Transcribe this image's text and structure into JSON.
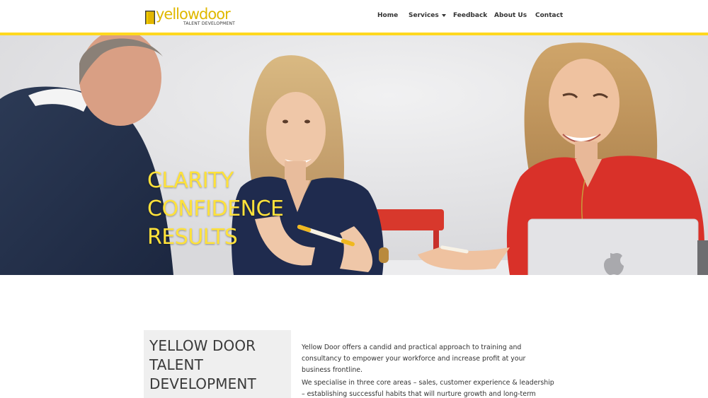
{
  "brand": {
    "name": "yellowdoor",
    "tagline": "TALENT DEVELOPMENT",
    "accent_color": "#ffd81f",
    "logo_text_color": "#e0b800"
  },
  "nav": {
    "items": [
      {
        "label": "Home"
      },
      {
        "label": "Services",
        "has_dropdown": true
      },
      {
        "label": "Feedback"
      },
      {
        "label": "About Us"
      },
      {
        "label": "Contact"
      }
    ]
  },
  "hero": {
    "lines": [
      "CLARITY",
      "CONFIDENCE",
      "RESULTS"
    ],
    "text_color": "#ffe23a"
  },
  "intro": {
    "title_lines": [
      "YELLOW DOOR",
      "TALENT",
      "DEVELOPMENT"
    ],
    "paragraph_1": "Yellow Door offers a candid and practical approach to training and consultancy to empower your workforce and increase profit at your business frontline.",
    "paragraph_2": "We specialise in three core areas – sales, customer experience & leadership – establishing successful habits that will nurture growth and long-term success in"
  }
}
